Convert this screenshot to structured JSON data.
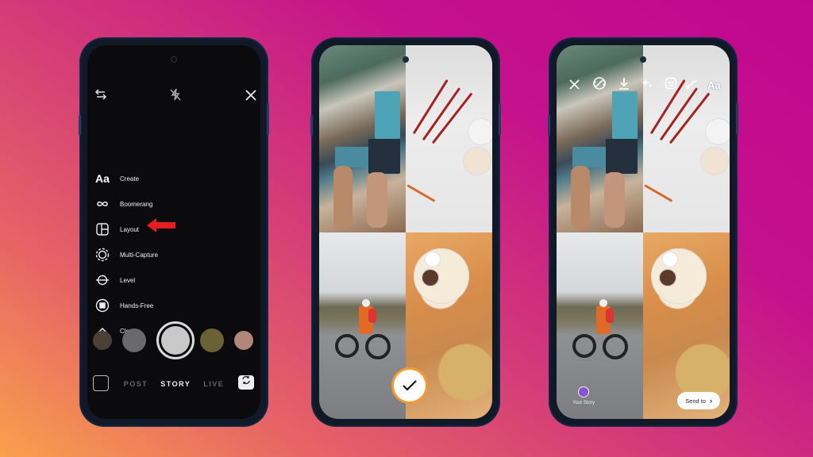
{
  "background": {
    "gradient_colors": [
      "#f8a14c",
      "#e66366",
      "#d33a78",
      "#c2078f"
    ]
  },
  "phones": [
    {
      "screen": "camera-modes",
      "top_icons": [
        "switch-camera-icon",
        "flash-off-icon",
        "close-icon"
      ],
      "menu": [
        {
          "icon": "text-icon",
          "icon_text": "Aa",
          "label": "Create"
        },
        {
          "icon": "infinity-icon",
          "label": "Boomerang"
        },
        {
          "icon": "layout-icon",
          "label": "Layout",
          "highlighted": true
        },
        {
          "icon": "multi-capture-icon",
          "label": "Multi-Capture"
        },
        {
          "icon": "level-icon",
          "label": "Level"
        },
        {
          "icon": "hands-free-icon",
          "label": "Hands-Free"
        },
        {
          "icon": "chevron-up-icon",
          "label": "Close"
        }
      ],
      "pointer_color": "#e41e1e",
      "modes": [
        {
          "label": "POST",
          "active": false
        },
        {
          "label": "STORY",
          "active": true
        },
        {
          "label": "LIVE",
          "active": false
        }
      ]
    },
    {
      "screen": "layout-grid",
      "panes": [
        "magazines-books",
        "colored-pencils",
        "cyclist-on-road",
        "food-spread"
      ],
      "confirm_color": "#f59a33"
    },
    {
      "screen": "story-editor",
      "tools": [
        {
          "icon": "close-icon",
          "glyph": "✕"
        },
        {
          "icon": "link-icon",
          "glyph": "🔗"
        },
        {
          "icon": "download-icon",
          "glyph": "⤓"
        },
        {
          "icon": "effects-icon",
          "glyph": "✦"
        },
        {
          "icon": "sticker-icon",
          "glyph": "☺"
        },
        {
          "icon": "draw-icon",
          "glyph": "✎"
        },
        {
          "icon": "text-icon",
          "glyph": "Aa"
        }
      ],
      "your_story_label": "Your Story",
      "your_story_color": "#8655d6",
      "send_to_label": "Send to",
      "send_to_chevron": "›"
    }
  ]
}
